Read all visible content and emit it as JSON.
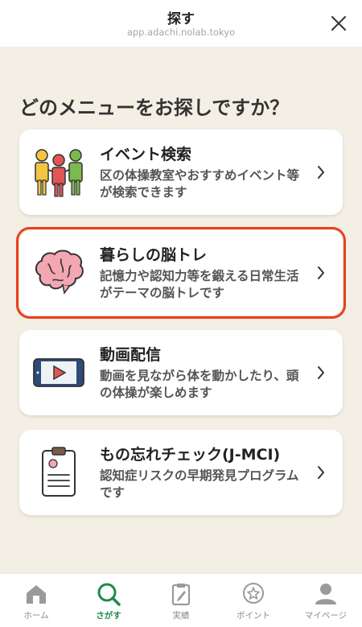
{
  "header": {
    "title": "探す",
    "url": "app.adachi.nolab.tokyo"
  },
  "question": "どのメニューをお探しですか？",
  "cards": [
    {
      "title": "イベント検索",
      "desc": "区の体操教室やおすすめイベント等が検索できます",
      "icon": "people-icon"
    },
    {
      "title": "暮らしの脳トレ",
      "desc": "記憶力や認知力等を鍛える日常生活がテーマの脳トレです",
      "icon": "brain-icon",
      "highlighted": true
    },
    {
      "title": "動画配信",
      "desc": "動画を見ながら体を動かしたり、頭の体操が楽しめます",
      "icon": "video-icon"
    },
    {
      "title": "もの忘れチェック(J-MCI)",
      "desc": "認知症リスクの早期発見プログラムです",
      "icon": "clipboard-icon"
    }
  ],
  "tabbar": {
    "items": [
      {
        "label": "ホーム",
        "icon": "home-icon",
        "active": false
      },
      {
        "label": "さがす",
        "icon": "search-icon",
        "active": true
      },
      {
        "label": "実績",
        "icon": "clipboard-icon",
        "active": false
      },
      {
        "label": "ポイント",
        "icon": "star-badge-icon",
        "active": false
      },
      {
        "label": "マイページ",
        "icon": "person-icon",
        "active": false
      }
    ]
  },
  "colors": {
    "accent": "#1f8a4c",
    "highlight": "#e8401c",
    "background": "#f4efe5"
  }
}
